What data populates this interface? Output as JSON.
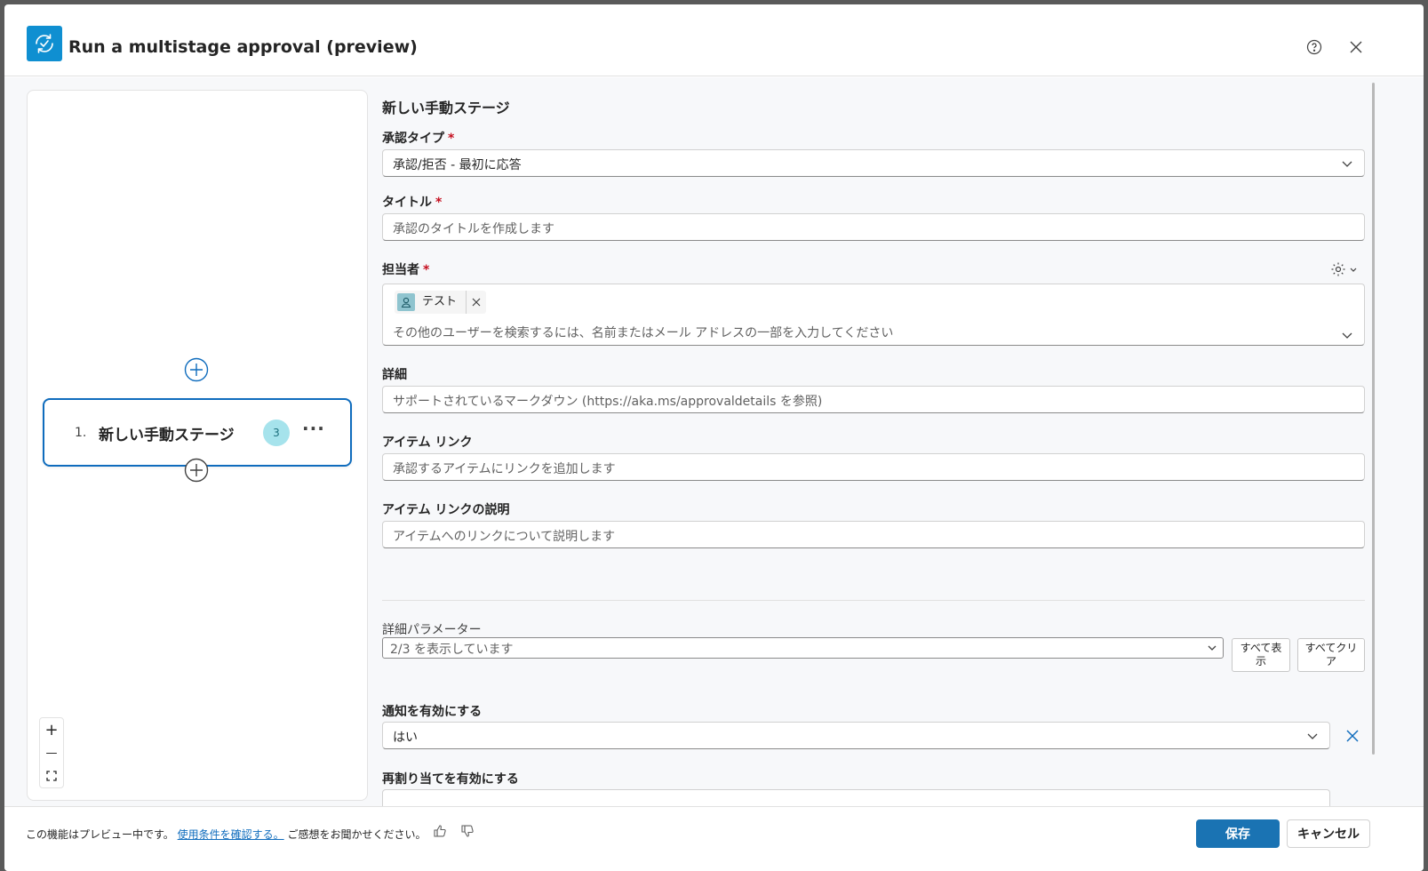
{
  "header": {
    "title": "Run a multistage approval (preview)",
    "help_icon": "question-circle-icon",
    "close_icon": "close-icon"
  },
  "canvas": {
    "stage": {
      "number": "1.",
      "name": "新しい手動ステージ",
      "badge_count": "3"
    },
    "zoom_in": "+",
    "zoom_out": "—"
  },
  "form": {
    "section_title": "新しい手動ステージ",
    "approval_type": {
      "label": "承認タイプ",
      "required_mark": "*",
      "value": "承認/拒否 - 最初に応答"
    },
    "title": {
      "label": "タイトル",
      "required_mark": "*",
      "placeholder": "承認のタイトルを作成します"
    },
    "assignee": {
      "label": "担当者",
      "required_mark": "*",
      "chip": "テスト",
      "placeholder": "その他のユーザーを検索するには、名前またはメール アドレスの一部を入力してください"
    },
    "details": {
      "label": "詳細",
      "placeholder": "サポートされているマークダウン (https://aka.ms/approvaldetails を参照)"
    },
    "item_link": {
      "label": "アイテム リンク",
      "placeholder": "承認するアイテムにリンクを追加します"
    },
    "item_link_desc": {
      "label": "アイテム リンクの説明",
      "placeholder": "アイテムへのリンクについて説明します"
    },
    "advanced": {
      "label": "詳細パラメーター",
      "value": "2/3 を表示しています",
      "show_all_line1": "すべて表",
      "show_all_line2": "示",
      "clear_all_line1": "すべてクリ",
      "clear_all_line2": "ア"
    },
    "notifications": {
      "label": "通知を有効にする",
      "value": "はい"
    },
    "reassign": {
      "label": "再割り当てを有効にする"
    }
  },
  "footer": {
    "preview_text": "この機能はプレビュー中です。",
    "terms_link": "使用条件を確認する。",
    "feedback_text": "ご感想をお聞かせください。",
    "save": "保存",
    "cancel": "キャンセル"
  },
  "colors": {
    "accent": "#0f6cbd",
    "primary_button": "#1a73b3",
    "app_icon": "#0f8fd1",
    "badge": "#a6e3ec"
  }
}
